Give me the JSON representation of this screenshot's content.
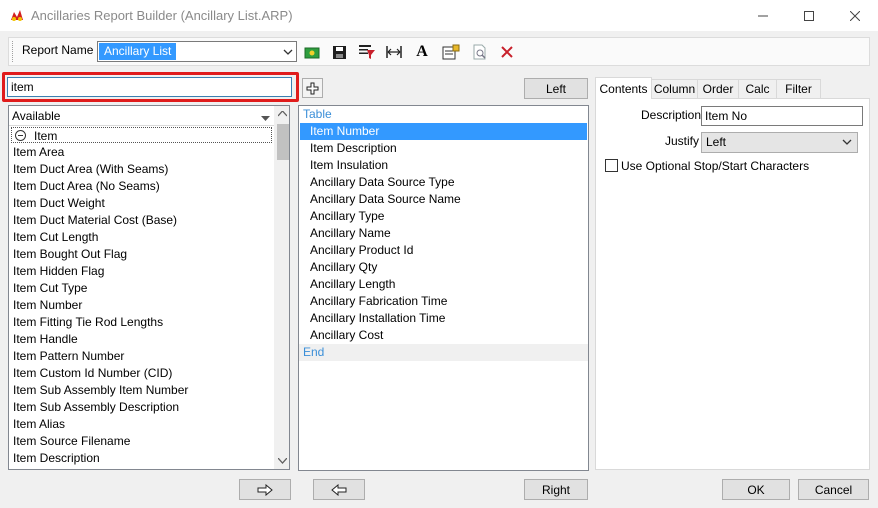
{
  "window": {
    "title": "Ancillaries Report Builder (Ancillary List.ARP)",
    "accent_color": "#3399ff"
  },
  "toolbar": {
    "report_name_label": "Report Name",
    "report_name_value": "Ancillary List",
    "icons": [
      "new-report-icon",
      "save-icon",
      "filter-list-icon",
      "column-width-icon",
      "font-icon",
      "properties-icon",
      "print-preview-icon",
      "delete-icon"
    ],
    "font_glyph": "A"
  },
  "search": {
    "value": "item",
    "highlight_color": "#e01c1c"
  },
  "buttons": {
    "left": "Left",
    "right": "Right",
    "ok": "OK",
    "cancel": "Cancel"
  },
  "available": {
    "header": "Available",
    "group": "Item",
    "items": [
      "Item Area",
      "Item Duct Area (With Seams)",
      "Item Duct Area (No Seams)",
      "Item Duct Weight",
      "Item Duct Material Cost (Base)",
      "Item Cut Length",
      "Item Bought Out Flag",
      "Item Hidden Flag",
      "Item Cut Type",
      "Item Number",
      "Item Fitting Tie Rod Lengths",
      "Item Handle",
      "Item Pattern Number",
      "Item Custom Id Number (CID)",
      "Item Sub Assembly Item Number",
      "Item Sub Assembly Description",
      "Item Alias",
      "Item Source Filename",
      "Item Description"
    ]
  },
  "table": {
    "start": "Table",
    "end": "End",
    "selected_index": 0,
    "rows": [
      "Item Number",
      "Item Description",
      "Item Insulation",
      "Ancillary Data Source Type",
      "Ancillary Data Source Name",
      "Ancillary Type",
      "Ancillary Name",
      "Ancillary Product Id",
      "Ancillary Qty",
      "Ancillary Length",
      "Ancillary Fabrication Time",
      "Ancillary Installation Time",
      "Ancillary Cost"
    ]
  },
  "tabs": {
    "contents": "Contents",
    "column": "Column",
    "order": "Order",
    "calc": "Calc",
    "filter": "Filter",
    "active": "contents"
  },
  "contents": {
    "description_label": "Description",
    "description_value": "Item No",
    "justify_label": "Justify",
    "justify_value": "Left",
    "stopstart_label": "Use Optional Stop/Start Characters",
    "stopstart_checked": false
  }
}
